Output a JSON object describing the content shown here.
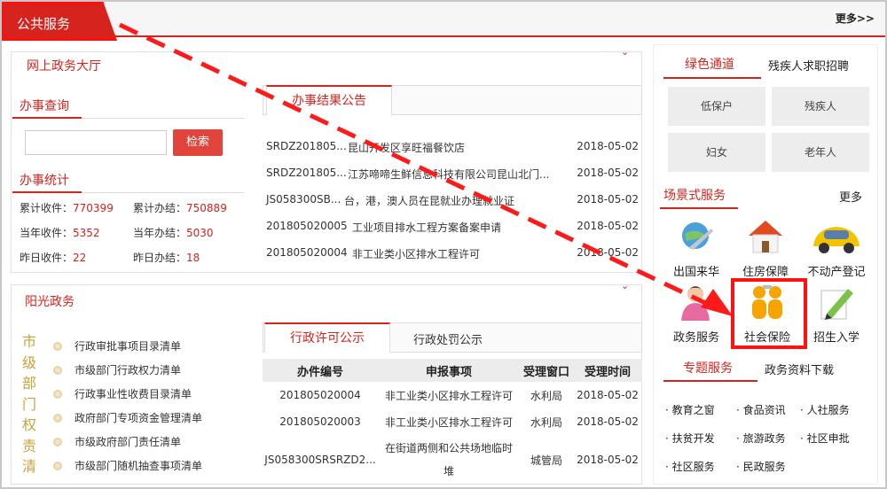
{
  "header": {
    "tab": "公共服务",
    "more": "更多>>"
  },
  "online_hall": {
    "title": "网上政务大厅",
    "query_title": "办事查询",
    "search_button": "检索",
    "stats_title": "办事统计",
    "stats": [
      {
        "label": "累计收件：",
        "value": "770399"
      },
      {
        "label": "累计办结：",
        "value": "750889"
      },
      {
        "label": "当年收件：",
        "value": "5352"
      },
      {
        "label": "当年办结：",
        "value": "5030"
      },
      {
        "label": "昨日收件：",
        "value": "22"
      },
      {
        "label": "昨日办结：",
        "value": "18"
      }
    ],
    "notice_tab": "办事结果公告",
    "notices": [
      {
        "code": "SRDZ201805...",
        "title": "昆山开发区享旺福餐饮店",
        "date": "2018-05-02"
      },
      {
        "code": "SRDZ201805...",
        "title": "江苏啼啼生鲜信息科技有限公司昆山北门...",
        "date": "2018-05-02"
      },
      {
        "code": "JS058300SB...",
        "title": "台，港，澳人员在昆就业办理就业证",
        "date": "2018-05-02"
      },
      {
        "code": "201805020005",
        "title": "工业项目排水工程方案备案申请",
        "date": "2018-05-02"
      },
      {
        "code": "201805020004",
        "title": "非工业类小区排水工程许可",
        "date": "2018-05-02"
      }
    ]
  },
  "sunshine": {
    "title": "阳光政务",
    "vertical": [
      "市",
      "级",
      "部",
      "门",
      "权",
      "责",
      "清"
    ],
    "items": [
      "行政审批事项目录清单",
      "市级部门行政权力清单",
      "行政事业性收费目录清单",
      "政府部门专项资金管理清单",
      "市级政府部门责任清单",
      "市级部门随机抽查事项清单"
    ],
    "tab_active": "行政许可公示",
    "tab_other": "行政处罚公示",
    "table": {
      "headers": [
        "办件编号",
        "申报事项",
        "受理窗口",
        "受理时间"
      ],
      "rows": [
        [
          "201805020004",
          "非工业类小区排水工程许可",
          "水利局",
          "2018-05-02"
        ],
        [
          "201805020003",
          "非工业类小区排水工程许可",
          "水利局",
          "2018-05-02"
        ],
        [
          "JS058300SRSRZD2...",
          "在街道两侧和公共场地临时堆",
          "城管局",
          "2018-05-02"
        ]
      ]
    }
  },
  "right": {
    "green_tab": "绿色通道",
    "disabled_jobs": "残疾人求职招聘",
    "green_buttons": [
      "低保户",
      "残疾人",
      "妇女",
      "老年人"
    ],
    "scene_title": "场景式服务",
    "scene_more": "更多",
    "services": [
      "出国来华",
      "住房保障",
      "不动产登记",
      "政务服务",
      "社会保险",
      "招生入学"
    ],
    "topic_tab": "专题服务",
    "docs_tab": "政务资料下载",
    "links": [
      "教育之窗",
      "食品资讯",
      "人社服务",
      "扶贫开发",
      "旅游政务",
      "社区申批",
      "社区服务",
      "民政服务"
    ]
  },
  "colors": {
    "accent": "#d7231e",
    "arrow": "#ff1a1a"
  }
}
